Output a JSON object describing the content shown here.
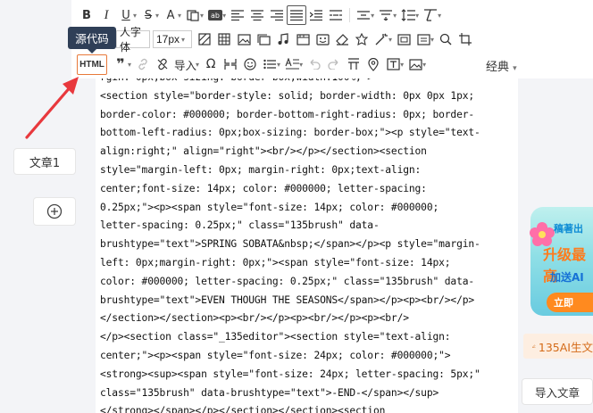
{
  "toolbar": {
    "font_family_value": "人字体",
    "font_size_value": "17px",
    "import_label": "导入",
    "classic_label": "经典",
    "html_button_label": "HTML",
    "tooltip": "源代码",
    "icons_row1": [
      "bold-icon",
      "italic-icon",
      "underline-icon",
      "strikethrough-icon",
      "font-color-icon",
      "copy-format-icon",
      "text-replace-icon",
      "align-left-icon",
      "align-center-icon",
      "align-right-icon",
      "align-justify-icon",
      "indent-icon",
      "distribute-icon",
      "line-spacing-icon",
      "paragraph-spacing-icon",
      "row-height-icon",
      "clear-format-icon"
    ],
    "icons_row2": [
      "background-icon",
      "table-icon",
      "image-icon",
      "image-gallery-icon",
      "music-icon",
      "video-icon",
      "emoji-icon",
      "eraser-icon",
      "stamp-icon",
      "magic-icon",
      "layout-icon",
      "frame-icon",
      "search-icon",
      "crop-icon"
    ]
  },
  "editor": {
    "code_lines": [
      "rgin: 0px;box-sizing: border-box;width:100%;\">",
      "<section style=\"border-style: solid; border-width: 0px 0px 1px;",
      "border-color: #000000; border-bottom-right-radius: 0px; border-",
      "bottom-left-radius: 0px;box-sizing: border-box;\"><p style=\"text-",
      "align:right;\" align=\"right\"><br/></p></section><section",
      "style=\"margin-left: 0px; margin-right: 0px;text-align:",
      "center;font-size: 14px; color: #000000; letter-spacing:",
      "0.25px;\"><p><span style=\"font-size: 14px; color: #000000;",
      "letter-spacing: 0.25px;\" class=\"135brush\" data-",
      "brushtype=\"text\">SPRING SOBATA&nbsp;</span></p><p style=\"margin-",
      "left: 0px;margin-right: 0px;\"><span style=\"font-size: 14px;",
      "color: #000000; letter-spacing: 0.25px;\" class=\"135brush\" data-",
      "brushtype=\"text\">EVEN THOUGH THE SEASONS</span></p><p><br/></p>",
      "</section></section><p><br/></p><p><br/></p><p><br/>",
      "</p><section class=\"_135editor\"><section style=\"text-align:",
      "center;\"><p><span style=\"font-size: 24px; color: #000000;\">",
      "<strong><sup><span style=\"font-size: 24px; letter-spacing: 5px;\"",
      "class=\"135brush\" data-brushtype=\"text\">-END-</span></sup>",
      "</strong></span></p></section></section><section"
    ]
  },
  "left_panel": {
    "article_tab": "文章1"
  },
  "right_panel": {
    "promo_line1": "稿著出",
    "promo_line2": "升级最高",
    "promo_line3": "加送AI",
    "promo_button": "立即",
    "ai_chip": "135AI生文",
    "import_article": "导入文章"
  },
  "colors": {
    "accent_orange": "#e8793a",
    "tooltip_bg": "#2f3f57",
    "arrow_red": "#e8383d"
  }
}
